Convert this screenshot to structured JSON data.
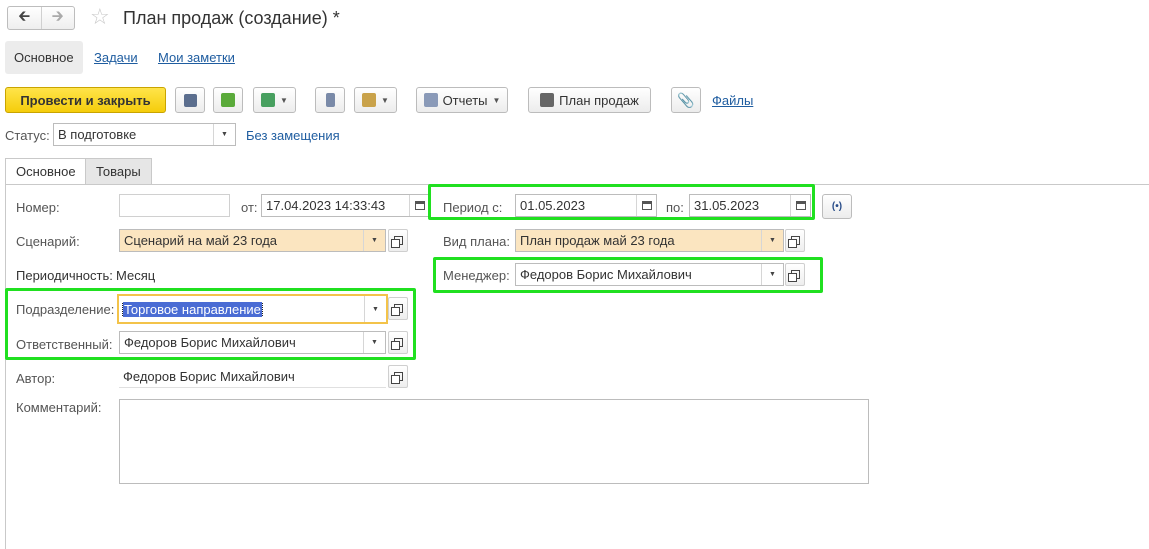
{
  "window": {
    "title": "План продаж (создание) *"
  },
  "sections": {
    "main": "Основное",
    "tasks": "Задачи",
    "notes": "Мои заметки"
  },
  "toolbar": {
    "post_close": "Провести и закрыть",
    "reports": "Отчеты",
    "print_plan": "План продаж",
    "files": "Файлы"
  },
  "status": {
    "label": "Статус:",
    "value": "В подготовке",
    "no_replace": "Без замещения"
  },
  "tabs": {
    "main": "Основное",
    "goods": "Товары"
  },
  "form": {
    "number_label": "Номер:",
    "number_value": "",
    "from_label": "от:",
    "from_value": "17.04.2023 14:33:43",
    "period_label": "Период с:",
    "period_from": "01.05.2023",
    "period_to_label": "по:",
    "period_to": "31.05.2023",
    "scenario_label": "Сценарий:",
    "scenario_value": "Сценарий на май 23 года",
    "plan_type_label": "Вид плана:",
    "plan_type_value": "План продаж май 23 года",
    "periodicity_label": "Периодичность:",
    "periodicity_value": "Месяц",
    "manager_label": "Менеджер:",
    "manager_value": "Федоров Борис Михайлович",
    "division_label": "Подразделение:",
    "division_value": "Торговое направление",
    "responsible_label": "Ответственный:",
    "responsible_value": "Федоров Борис Михайлович",
    "author_label": "Автор:",
    "author_value": "Федоров Борис Михайлович",
    "comment_label": "Комментарий:",
    "comment_value": ""
  },
  "colors": {
    "highlight_box": "#20e020",
    "required_fill": "#fbe5c0",
    "link": "#1f5da0",
    "primary_button": "#f5cd0b"
  }
}
